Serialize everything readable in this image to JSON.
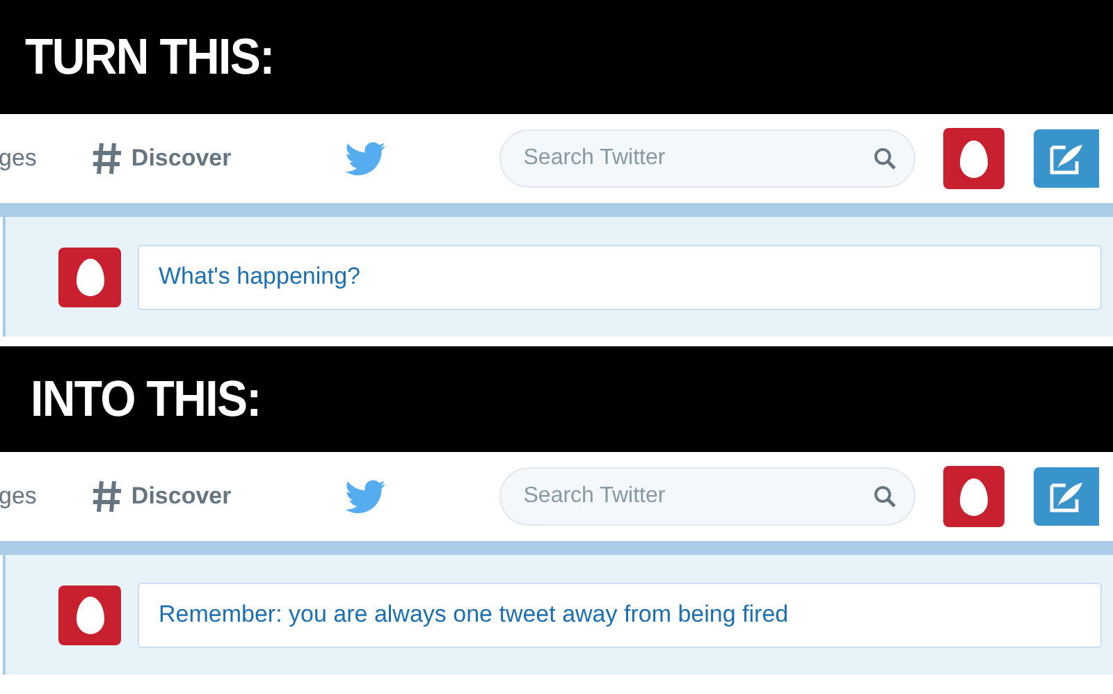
{
  "panels": [
    {
      "caption": "TURN THIS:",
      "nav_cut": "ges",
      "discover": "Discover",
      "search": {
        "placeholder": "Search Twitter"
      },
      "composer": "What's happening?"
    },
    {
      "caption": "INTO THIS:",
      "nav_cut": "ges",
      "discover": "Discover",
      "search": {
        "placeholder": "Search Twitter"
      },
      "composer": "Remember: you are always one tweet away from being fired"
    }
  ]
}
